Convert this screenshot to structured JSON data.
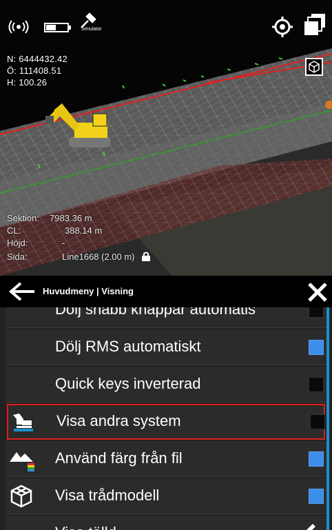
{
  "status": {
    "simulator_label": "Simulator"
  },
  "coordinates": {
    "north": "N: 6444432.42",
    "east": "Ö: 111408.51",
    "height": "H: 100.26"
  },
  "info": [
    {
      "key": "Sektion:",
      "value": "7983.36 m"
    },
    {
      "key": "CL:",
      "value": "388.14 m"
    },
    {
      "key": "Höjd:",
      "value": "-"
    },
    {
      "key": "Sida:",
      "value": "Line1668 (2.00 m)"
    }
  ],
  "menu": {
    "breadcrumb": "Huvudmeny | Visning",
    "items": [
      {
        "label": "Dölj snabb knappar automatis",
        "checked": false
      },
      {
        "label": "Dölj RMS automatiskt",
        "checked": true
      },
      {
        "label": "Quick keys  inverterad",
        "checked": false
      },
      {
        "label": "Visa andra system",
        "checked": false,
        "icon": "excavator-icon",
        "selected": true
      },
      {
        "label": "Använd färg från fil",
        "checked": true,
        "icon": "terrain-color-icon"
      },
      {
        "label": "Visa trådmodell",
        "checked": true,
        "icon": "wireframe-cube-icon"
      },
      {
        "label": "Visa tälld",
        "checked": false,
        "icon": "pencil-icon"
      }
    ]
  },
  "colors": {
    "accent_blue": "#3d8ee8",
    "selection_red": "#e01e1e",
    "scroll_blue": "#1c8fc9"
  }
}
